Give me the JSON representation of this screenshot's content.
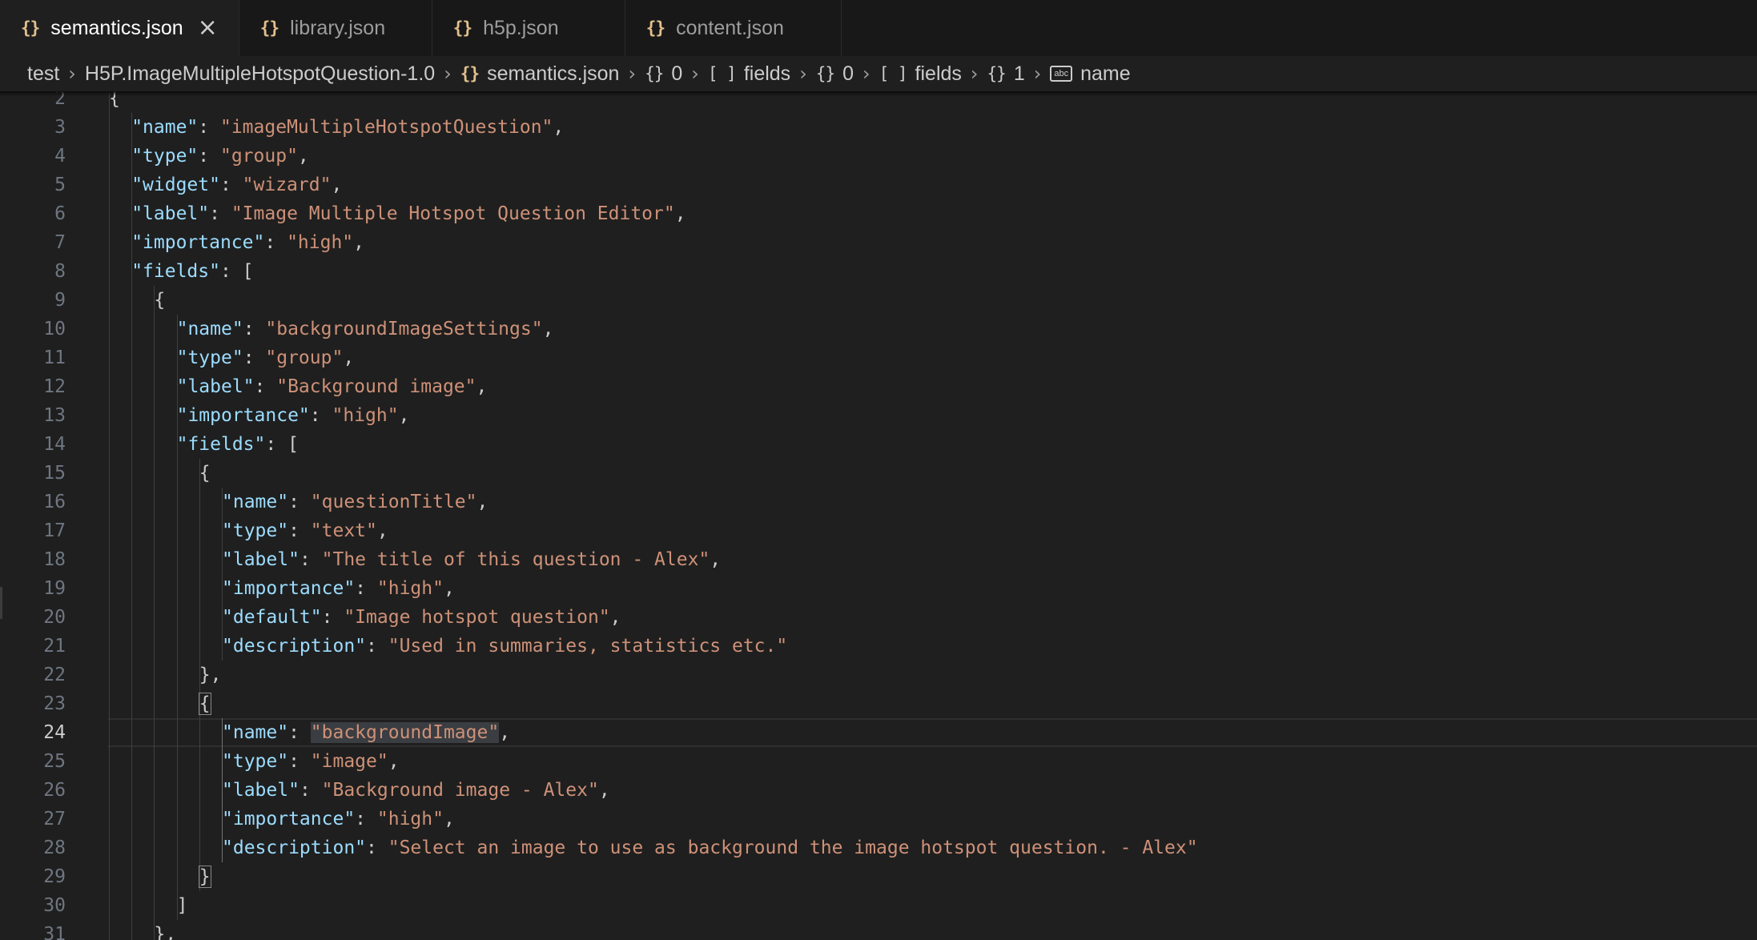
{
  "tabs": [
    {
      "label": "semantics.json",
      "icon": "{}",
      "active": true
    },
    {
      "label": "library.json",
      "icon": "{}",
      "active": false
    },
    {
      "label": "h5p.json",
      "icon": "{}",
      "active": false
    },
    {
      "label": "content.json",
      "icon": "{}",
      "active": false
    }
  ],
  "breadcrumb": {
    "items": [
      {
        "label": "test",
        "icon": ""
      },
      {
        "label": "H5P.ImageMultipleHotspotQuestion-1.0",
        "icon": ""
      },
      {
        "label": "semantics.json",
        "icon": "{}"
      },
      {
        "label": "0",
        "icon": "{}"
      },
      {
        "label": "fields",
        "icon": "[ ]"
      },
      {
        "label": "0",
        "icon": "{}"
      },
      {
        "label": "fields",
        "icon": "[ ]"
      },
      {
        "label": "1",
        "icon": "{}"
      },
      {
        "label": "name",
        "icon": "abc"
      }
    ]
  },
  "editor": {
    "current_line": 24,
    "lines": [
      {
        "n": "2",
        "indent": 1,
        "tokens": [
          [
            "p",
            "{"
          ]
        ]
      },
      {
        "n": "3",
        "indent": 2,
        "tokens": [
          [
            "k",
            "\"name\""
          ],
          [
            "p",
            ": "
          ],
          [
            "s",
            "\"imageMultipleHotspotQuestion\""
          ],
          [
            "p",
            ","
          ]
        ]
      },
      {
        "n": "4",
        "indent": 2,
        "tokens": [
          [
            "k",
            "\"type\""
          ],
          [
            "p",
            ": "
          ],
          [
            "s",
            "\"group\""
          ],
          [
            "p",
            ","
          ]
        ]
      },
      {
        "n": "5",
        "indent": 2,
        "tokens": [
          [
            "k",
            "\"widget\""
          ],
          [
            "p",
            ": "
          ],
          [
            "s",
            "\"wizard\""
          ],
          [
            "p",
            ","
          ]
        ]
      },
      {
        "n": "6",
        "indent": 2,
        "tokens": [
          [
            "k",
            "\"label\""
          ],
          [
            "p",
            ": "
          ],
          [
            "s",
            "\"Image Multiple Hotspot Question Editor\""
          ],
          [
            "p",
            ","
          ]
        ]
      },
      {
        "n": "7",
        "indent": 2,
        "tokens": [
          [
            "k",
            "\"importance\""
          ],
          [
            "p",
            ": "
          ],
          [
            "s",
            "\"high\""
          ],
          [
            "p",
            ","
          ]
        ]
      },
      {
        "n": "8",
        "indent": 2,
        "tokens": [
          [
            "k",
            "\"fields\""
          ],
          [
            "p",
            ": ["
          ]
        ]
      },
      {
        "n": "9",
        "indent": 3,
        "tokens": [
          [
            "p",
            "{"
          ]
        ]
      },
      {
        "n": "10",
        "indent": 4,
        "tokens": [
          [
            "k",
            "\"name\""
          ],
          [
            "p",
            ": "
          ],
          [
            "s",
            "\"backgroundImageSettings\""
          ],
          [
            "p",
            ","
          ]
        ]
      },
      {
        "n": "11",
        "indent": 4,
        "tokens": [
          [
            "k",
            "\"type\""
          ],
          [
            "p",
            ": "
          ],
          [
            "s",
            "\"group\""
          ],
          [
            "p",
            ","
          ]
        ]
      },
      {
        "n": "12",
        "indent": 4,
        "tokens": [
          [
            "k",
            "\"label\""
          ],
          [
            "p",
            ": "
          ],
          [
            "s",
            "\"Background image\""
          ],
          [
            "p",
            ","
          ]
        ]
      },
      {
        "n": "13",
        "indent": 4,
        "tokens": [
          [
            "k",
            "\"importance\""
          ],
          [
            "p",
            ": "
          ],
          [
            "s",
            "\"high\""
          ],
          [
            "p",
            ","
          ]
        ]
      },
      {
        "n": "14",
        "indent": 4,
        "tokens": [
          [
            "k",
            "\"fields\""
          ],
          [
            "p",
            ": ["
          ]
        ]
      },
      {
        "n": "15",
        "indent": 5,
        "tokens": [
          [
            "p",
            "{"
          ]
        ]
      },
      {
        "n": "16",
        "indent": 6,
        "tokens": [
          [
            "k",
            "\"name\""
          ],
          [
            "p",
            ": "
          ],
          [
            "s",
            "\"questionTitle\""
          ],
          [
            "p",
            ","
          ]
        ]
      },
      {
        "n": "17",
        "indent": 6,
        "tokens": [
          [
            "k",
            "\"type\""
          ],
          [
            "p",
            ": "
          ],
          [
            "s",
            "\"text\""
          ],
          [
            "p",
            ","
          ]
        ]
      },
      {
        "n": "18",
        "indent": 6,
        "tokens": [
          [
            "k",
            "\"label\""
          ],
          [
            "p",
            ": "
          ],
          [
            "s",
            "\"The title of this question - Alex\""
          ],
          [
            "p",
            ","
          ]
        ]
      },
      {
        "n": "19",
        "indent": 6,
        "tokens": [
          [
            "k",
            "\"importance\""
          ],
          [
            "p",
            ": "
          ],
          [
            "s",
            "\"high\""
          ],
          [
            "p",
            ","
          ]
        ]
      },
      {
        "n": "20",
        "indent": 6,
        "tokens": [
          [
            "k",
            "\"default\""
          ],
          [
            "p",
            ": "
          ],
          [
            "s",
            "\"Image hotspot question\""
          ],
          [
            "p",
            ","
          ]
        ]
      },
      {
        "n": "21",
        "indent": 6,
        "tokens": [
          [
            "k",
            "\"description\""
          ],
          [
            "p",
            ": "
          ],
          [
            "s",
            "\"Used in summaries, statistics etc.\""
          ]
        ]
      },
      {
        "n": "22",
        "indent": 5,
        "tokens": [
          [
            "p",
            "},"
          ]
        ]
      },
      {
        "n": "23",
        "indent": 5,
        "tokens": [
          [
            "bm",
            "{"
          ]
        ]
      },
      {
        "n": "24",
        "indent": 6,
        "tokens": [
          [
            "k",
            "\"name\""
          ],
          [
            "p",
            ": "
          ],
          [
            "sel",
            "\"backgroundImage\""
          ],
          [
            "p",
            ","
          ]
        ]
      },
      {
        "n": "25",
        "indent": 6,
        "tokens": [
          [
            "k",
            "\"type\""
          ],
          [
            "p",
            ": "
          ],
          [
            "s",
            "\"image\""
          ],
          [
            "p",
            ","
          ]
        ]
      },
      {
        "n": "26",
        "indent": 6,
        "tokens": [
          [
            "k",
            "\"label\""
          ],
          [
            "p",
            ": "
          ],
          [
            "s",
            "\"Background image - Alex\""
          ],
          [
            "p",
            ","
          ]
        ]
      },
      {
        "n": "27",
        "indent": 6,
        "tokens": [
          [
            "k",
            "\"importance\""
          ],
          [
            "p",
            ": "
          ],
          [
            "s",
            "\"high\""
          ],
          [
            "p",
            ","
          ]
        ]
      },
      {
        "n": "28",
        "indent": 6,
        "tokens": [
          [
            "k",
            "\"description\""
          ],
          [
            "p",
            ": "
          ],
          [
            "s",
            "\"Select an image to use as background the image hotspot question. - Alex\""
          ]
        ]
      },
      {
        "n": "29",
        "indent": 5,
        "tokens": [
          [
            "bm",
            "}"
          ]
        ]
      },
      {
        "n": "30",
        "indent": 4,
        "tokens": [
          [
            "p",
            "]"
          ]
        ]
      },
      {
        "n": "31",
        "indent": 3,
        "tokens": [
          [
            "p",
            "},"
          ]
        ]
      }
    ]
  },
  "colors": {
    "key": "#9cdcfe",
    "string": "#ce9178",
    "punct": "#cccccc",
    "json_icon": "#e2c08d",
    "line_number": "#6e7681"
  }
}
